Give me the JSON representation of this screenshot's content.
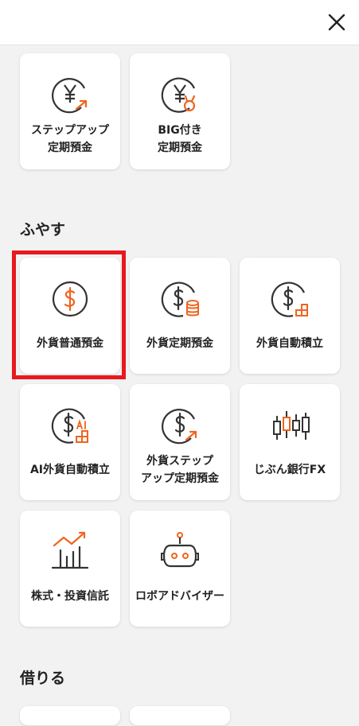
{
  "colors": {
    "accent": "#f0641e",
    "dark": "#333333",
    "highlight": "#e8191e"
  },
  "header": {
    "close_icon": "close-icon"
  },
  "sections": {
    "fuyasu": {
      "title": "ふやす"
    },
    "kariru": {
      "title": "借りる"
    }
  },
  "tiles": {
    "step_up": {
      "label": "ステップアップ\n定期預金",
      "icon": "yen-arrow-up-icon"
    },
    "big": {
      "label": "BIG付き\n定期預金",
      "icon": "yen-medal-icon"
    },
    "fx_ordinary": {
      "label": "外貨普通預金",
      "icon": "dollar-icon"
    },
    "fx_time": {
      "label": "外貨定期預金",
      "icon": "dollar-coins-icon"
    },
    "fx_auto": {
      "label": "外貨自動積立",
      "icon": "dollar-blocks-icon"
    },
    "ai_fx_auto": {
      "label": "AI外貨自動積立",
      "icon": "dollar-ai-blocks-icon"
    },
    "fx_step_up": {
      "label": "外貨ステップ\nアップ定期預金",
      "icon": "dollar-arrow-up-icon"
    },
    "jibun_fx": {
      "label": "じぶん銀行FX",
      "icon": "candlestick-icon"
    },
    "stocks": {
      "label": "株式・投資信託",
      "icon": "chart-trend-icon"
    },
    "robo": {
      "label": "ロボアドバイザー",
      "icon": "robot-icon"
    }
  }
}
